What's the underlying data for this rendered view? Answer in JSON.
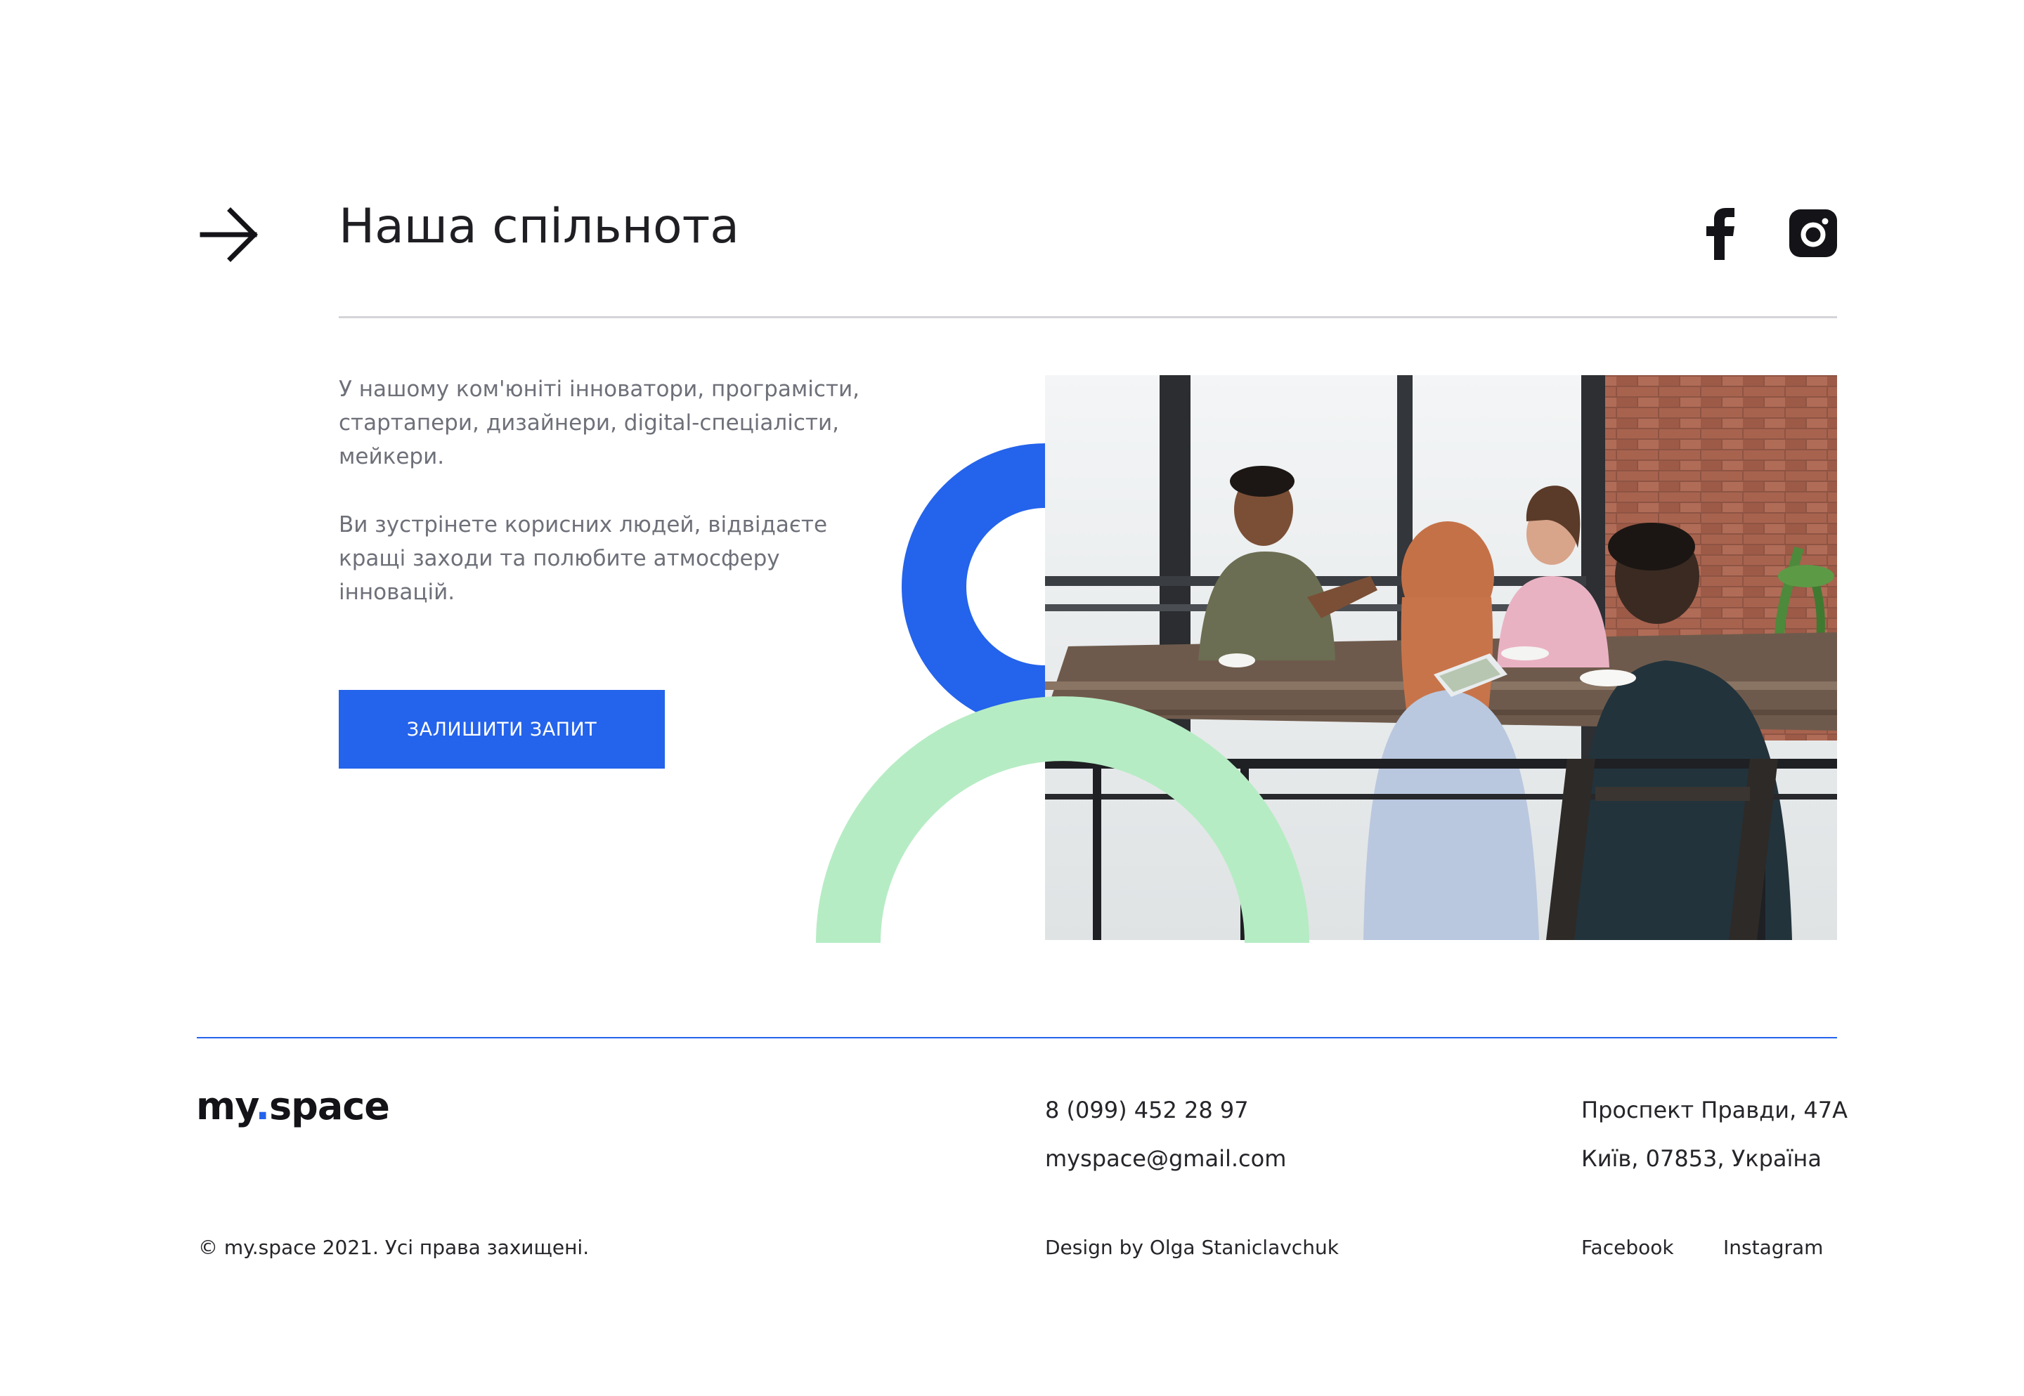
{
  "header": {
    "title": "Наша спільнота",
    "arrow_icon": "arrow-right-icon",
    "social_icons": [
      "facebook-icon",
      "instagram-icon"
    ]
  },
  "content": {
    "paragraph_1": "У нашому ком'юніті інноватори, програмісти, стартапери, дизайнери, digital-спеціалісти, мейкери.",
    "paragraph_2": "Ви зустрінете корисних людей, відвідаєте кращі заходи та полюбите атмосферу інновацій.",
    "cta_label": "ЗАЛИШИТИ ЗАПИТ"
  },
  "illustration": {
    "photo": "team-meeting-photo",
    "shapes": [
      "blue-semicircle-arc",
      "green-semicircle-arc"
    ]
  },
  "footer": {
    "logo_prefix": "my",
    "logo_dot": ".",
    "logo_suffix": "space",
    "phone": "8 (099) 452 28 97",
    "email": "myspace@gmail.com",
    "address_line_1": "Проспект Правди, 47А",
    "address_line_2": "Київ, 07853, Україна",
    "copyright": "© my.space 2021. Усі права захищені.",
    "design_credit": "Design by Olga Staniclavchuk",
    "links": [
      "Facebook",
      "Instagram"
    ]
  },
  "colors": {
    "accent_blue": "#2463eb",
    "accent_green": "#b6ecc4",
    "text_dark": "#1f1f23",
    "text_muted": "#6e7079",
    "divider": "#d4d4d8"
  }
}
